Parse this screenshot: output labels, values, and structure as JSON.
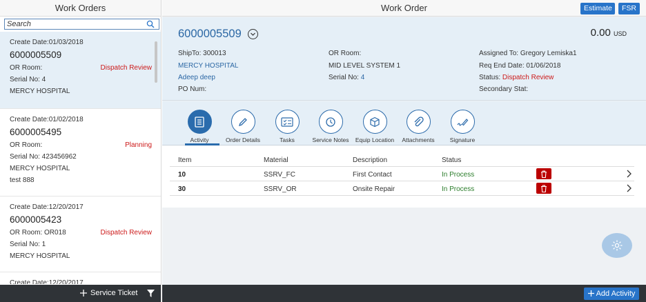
{
  "master": {
    "title": "Work Orders",
    "search_placeholder": "Search",
    "items": [
      {
        "create_date": "Create Date:01/03/2018",
        "number": "6000005509",
        "or_room": "OR Room:",
        "status": "Dispatch Review",
        "serial": "Serial No: 4",
        "hospital": "MERCY HOSPITAL",
        "extra": ""
      },
      {
        "create_date": "Create Date:01/02/2018",
        "number": "6000005495",
        "or_room": "OR Room:",
        "status": "Planning",
        "serial": "Serial No: 423456962",
        "hospital": "MERCY HOSPITAL",
        "extra": "test 888"
      },
      {
        "create_date": "Create Date:12/20/2017",
        "number": "6000005423",
        "or_room": "OR Room: OR018",
        "status": "Dispatch Review",
        "serial": "Serial No: 1",
        "hospital": "MERCY HOSPITAL",
        "extra": ""
      },
      {
        "create_date": "Create Date:12/20/2017",
        "number": "",
        "or_room": "",
        "status": "",
        "serial": "",
        "hospital": "",
        "extra": ""
      }
    ],
    "footer": {
      "service_ticket": "Service Ticket"
    }
  },
  "detail": {
    "title": "Work Order",
    "buttons": {
      "estimate": "Estimate",
      "fsr": "FSR"
    },
    "header": {
      "order_number": "6000005509",
      "amount": "0.00",
      "currency": "USD",
      "ship_to": "ShipTo: 300013",
      "hospital": "MERCY HOSPITAL",
      "contact": "Adeep deep",
      "po_num": "PO Num:",
      "or_room": "OR Room:",
      "system": "MID LEVEL SYSTEM 1",
      "serial_label": "Serial No:",
      "serial_value": "4",
      "assigned_to": "Assigned To: Gregory Lemiska1",
      "req_end_date": "Req End Date: 01/06/2018",
      "status_label": "Status:",
      "status_value": "Dispatch Review",
      "secondary_stat": "Secondary Stat:"
    },
    "tabs": [
      {
        "label": "Activity",
        "icon": "activity-icon"
      },
      {
        "label": "Order Details",
        "icon": "pencil-icon"
      },
      {
        "label": "Tasks",
        "icon": "checklist-icon"
      },
      {
        "label": "Service Notes",
        "icon": "clock-icon"
      },
      {
        "label": "Equip Location",
        "icon": "cube-icon"
      },
      {
        "label": "Attachments",
        "icon": "paperclip-icon"
      },
      {
        "label": "Signature",
        "icon": "signature-icon"
      }
    ],
    "table": {
      "columns": [
        "Item",
        "Material",
        "Description",
        "Status"
      ],
      "rows": [
        {
          "item": "10",
          "material": "SSRV_FC",
          "description": "First Contact",
          "status": "In Process"
        },
        {
          "item": "30",
          "material": "SSRV_OR",
          "description": "Onsite Repair",
          "status": "In Process"
        }
      ]
    },
    "footer": {
      "add_activity": "Add Activity"
    }
  },
  "colors": {
    "accent": "#2874c9",
    "status_red": "#cc1919",
    "status_green": "#2b7d2b",
    "delete_red": "#bb0000"
  }
}
